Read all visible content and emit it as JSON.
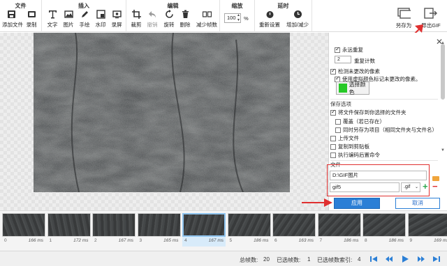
{
  "ribbon": {
    "groups": [
      {
        "title": "文件",
        "buttons": [
          "添加文件",
          "录制"
        ]
      },
      {
        "title": "插入",
        "buttons": [
          "文字",
          "图片",
          "手绘",
          "水印",
          "录屏"
        ]
      },
      {
        "title": "编辑",
        "buttons": [
          "裁剪",
          "撤销",
          "旋转",
          "删除",
          "减少帧数"
        ]
      },
      {
        "title": "缩放",
        "zoom_value": "100",
        "zoom_unit": "%"
      },
      {
        "title": "延时",
        "buttons": [
          "重新设置",
          "增加/减少"
        ]
      }
    ],
    "save_as": "另存为",
    "export_gif": "导出GIF"
  },
  "panel": {
    "loop_forever": "永远重复",
    "repeat_count_value": "2",
    "repeat_count_label": "重复计数",
    "detect_unchanged": "检测未更改的像素",
    "use_dummy_color": "使用虚拟颜色标记未更改的像素。",
    "choose_color": "选择颜色",
    "dummy_color": "#27c927",
    "save_options_title": "保存选项",
    "save_to_folder": "将文件保存到你选择的文件夹",
    "overwrite": "覆盖（若已存在）",
    "save_as_project": "同时另存为项目（相同文件夹与文件名）",
    "upload": "上传文件",
    "copy_clipboard": "复制到剪贴板",
    "run_command": "执行编码后置命令",
    "file_section": "文件",
    "folder_path": "D:\\GIF图片",
    "file_name": "gif5",
    "extension": ".gif",
    "apply": "应用",
    "cancel": "取消"
  },
  "frames": [
    {
      "index": "0",
      "ms": "166 ms"
    },
    {
      "index": "1",
      "ms": "172 ms"
    },
    {
      "index": "2",
      "ms": "167 ms"
    },
    {
      "index": "3",
      "ms": "165 ms"
    },
    {
      "index": "4",
      "ms": "167 ms"
    },
    {
      "index": "5",
      "ms": "186 ms"
    },
    {
      "index": "6",
      "ms": "163 ms"
    },
    {
      "index": "7",
      "ms": "186 ms"
    },
    {
      "index": "8",
      "ms": "186 ms"
    },
    {
      "index": "9",
      "ms": "169 ms"
    }
  ],
  "selected_frame": "4",
  "status": {
    "total_frames_label": "总帧数:",
    "total_frames": "20",
    "selected_frames_label": "已选帧数:",
    "selected_frames": "1",
    "selected_index_label": "已选帧数索引:",
    "selected_index": "4"
  },
  "colors": {
    "accent": "#2b7fd6",
    "annotation": "#e03030"
  }
}
